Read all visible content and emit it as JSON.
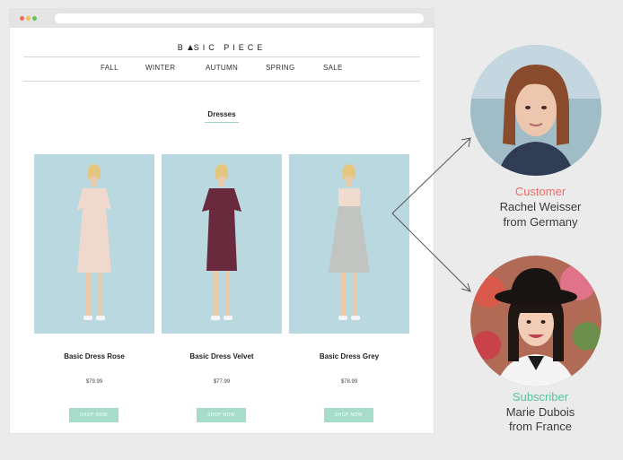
{
  "browser": {
    "brand": "BASIC PIECE"
  },
  "nav": {
    "items": [
      "FALL",
      "WINTER",
      "AUTUMN",
      "SPRING",
      "SALE"
    ]
  },
  "section": {
    "title": "Dresses"
  },
  "products": [
    {
      "name": "Basic Dress Rose",
      "price": "$79.99",
      "button": "SHOP NOW",
      "dress_color": "#efd9cd"
    },
    {
      "name": "Basic Dress Velvet",
      "price": "$77.99",
      "button": "SHOP NOW",
      "dress_color": "#6a2a3d"
    },
    {
      "name": "Basic Dress Grey",
      "price": "$78.99",
      "button": "SHOP NOW",
      "dress_color": "#c2c4c2"
    }
  ],
  "personas": [
    {
      "role": "Customer",
      "name": "Rachel Weisser",
      "origin": "from Germany",
      "role_color": "#ef6c67"
    },
    {
      "role": "Subscriber",
      "name": "Marie Dubois",
      "origin": "from France",
      "role_color": "#55c29c"
    }
  ],
  "colors": {
    "accent": "#a6dcc9",
    "photo_bg": "#b9d8e0"
  }
}
